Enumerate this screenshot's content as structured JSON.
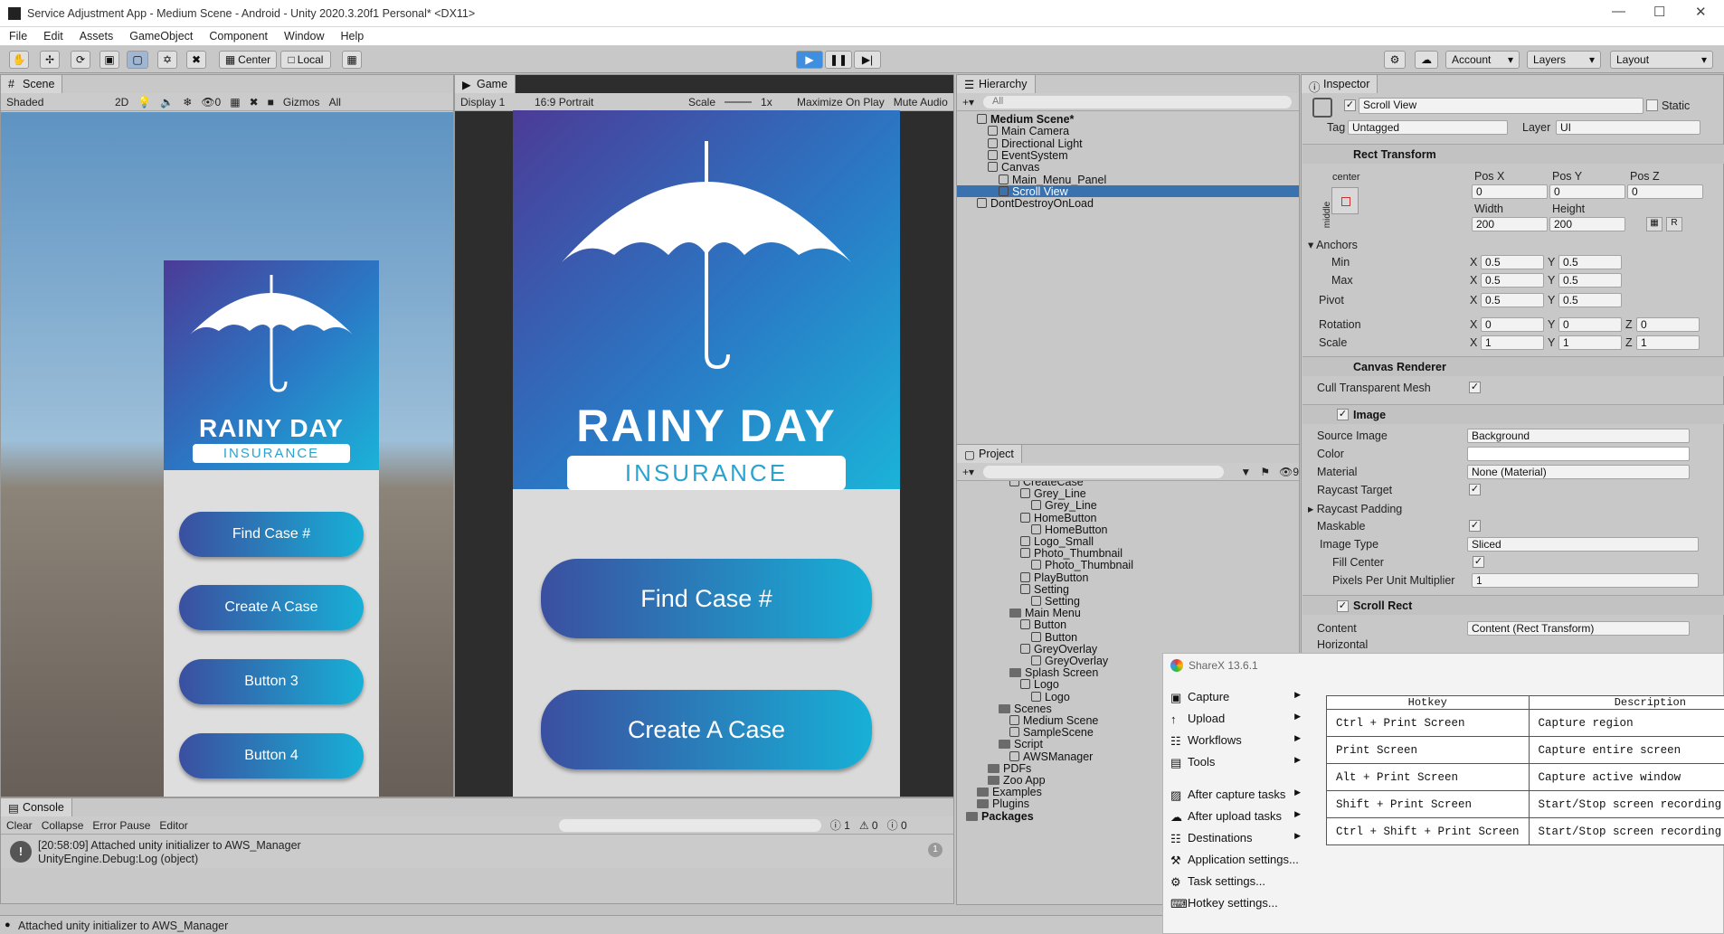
{
  "window": {
    "title": "Service Adjustment App - Medium Scene - Android - Unity 2020.3.20f1 Personal* <DX11>"
  },
  "menu": [
    "File",
    "Edit",
    "Assets",
    "GameObject",
    "Component",
    "Window",
    "Help"
  ],
  "toolbar": {
    "pivot_label": "Center",
    "space_label": "Local",
    "account": "Account",
    "layers": "Layers",
    "layout": "Layout"
  },
  "scene": {
    "tab": "Scene",
    "shading": "Shaded",
    "mode2d": "2D",
    "gizmos": "Gizmos",
    "hidden_count": "0",
    "search_hint": "All"
  },
  "game": {
    "tab": "Game",
    "display": "Display 1",
    "aspect": "16:9 Portrait",
    "scale_label": "Scale",
    "scale_value": "1x",
    "maximize": "Maximize On Play",
    "mute": "Mute Audio"
  },
  "app_screen": {
    "title": "RAINY DAY",
    "subtitle": "INSURANCE",
    "buttons": [
      "Find Case #",
      "Create A Case",
      "Button 3",
      "Button 4"
    ]
  },
  "hierarchy": {
    "tab": "Hierarchy",
    "search": "All",
    "items": [
      {
        "label": "Medium Scene*",
        "depth": 0,
        "kind": "scene"
      },
      {
        "label": "Main Camera",
        "depth": 1,
        "kind": "obj"
      },
      {
        "label": "Directional Light",
        "depth": 1,
        "kind": "obj"
      },
      {
        "label": "EventSystem",
        "depth": 1,
        "kind": "obj"
      },
      {
        "label": "Canvas",
        "depth": 1,
        "kind": "obj"
      },
      {
        "label": "Main_Menu_Panel",
        "depth": 2,
        "kind": "obj"
      },
      {
        "label": "Scroll View",
        "depth": 2,
        "kind": "obj"
      },
      {
        "label": "DontDestroyOnLoad",
        "depth": 0,
        "kind": "scene"
      }
    ]
  },
  "project": {
    "tab": "Project",
    "hidden_count": "9",
    "items": [
      {
        "label": "CreateCase",
        "depth": 4,
        "kind": "obj"
      },
      {
        "label": "Grey_Line",
        "depth": 5,
        "kind": "obj"
      },
      {
        "label": "Grey_Line",
        "depth": 6,
        "kind": "obj"
      },
      {
        "label": "HomeButton",
        "depth": 5,
        "kind": "obj"
      },
      {
        "label": "HomeButton",
        "depth": 6,
        "kind": "obj"
      },
      {
        "label": "Logo_Small",
        "depth": 5,
        "kind": "obj"
      },
      {
        "label": "Photo_Thumbnail",
        "depth": 5,
        "kind": "obj"
      },
      {
        "label": "Photo_Thumbnail",
        "depth": 6,
        "kind": "obj"
      },
      {
        "label": "PlayButton",
        "depth": 5,
        "kind": "obj"
      },
      {
        "label": "Setting",
        "depth": 5,
        "kind": "obj"
      },
      {
        "label": "Setting",
        "depth": 6,
        "kind": "obj"
      },
      {
        "label": "Main Menu",
        "depth": 4,
        "kind": "folder"
      },
      {
        "label": "Button",
        "depth": 5,
        "kind": "obj"
      },
      {
        "label": "Button",
        "depth": 6,
        "kind": "obj"
      },
      {
        "label": "GreyOverlay",
        "depth": 5,
        "kind": "obj"
      },
      {
        "label": "GreyOverlay",
        "depth": 6,
        "kind": "obj"
      },
      {
        "label": "Splash Screen",
        "depth": 4,
        "kind": "folder"
      },
      {
        "label": "Logo",
        "depth": 5,
        "kind": "obj"
      },
      {
        "label": "Logo",
        "depth": 6,
        "kind": "obj"
      },
      {
        "label": "Scenes",
        "depth": 3,
        "kind": "folder"
      },
      {
        "label": "Medium Scene",
        "depth": 4,
        "kind": "obj"
      },
      {
        "label": "SampleScene",
        "depth": 4,
        "kind": "obj"
      },
      {
        "label": "Script",
        "depth": 3,
        "kind": "folder"
      },
      {
        "label": "AWSManager",
        "depth": 4,
        "kind": "obj"
      },
      {
        "label": "PDFs",
        "depth": 2,
        "kind": "folder"
      },
      {
        "label": "Zoo App",
        "depth": 2,
        "kind": "folder"
      },
      {
        "label": "Examples",
        "depth": 1,
        "kind": "folder"
      },
      {
        "label": "Plugins",
        "depth": 1,
        "kind": "folder"
      },
      {
        "label": "Packages",
        "depth": 0,
        "kind": "folder"
      }
    ]
  },
  "inspector": {
    "tab": "Inspector",
    "object_name": "Scroll View",
    "static": "Static",
    "tag_label": "Tag",
    "tag": "Untagged",
    "layer_label": "Layer",
    "layer": "UI",
    "rect_transform": {
      "title": "Rect Transform",
      "anchor_preset": "center",
      "anchor_side": "middle",
      "pos_x_label": "Pos X",
      "pos_y_label": "Pos Y",
      "pos_z_label": "Pos Z",
      "pos_x": "0",
      "pos_y": "0",
      "pos_z": "0",
      "width_label": "Width",
      "height_label": "Height",
      "width": "200",
      "height": "200",
      "anchors": "Anchors",
      "min": "Min",
      "max": "Max",
      "pivot": "Pivot",
      "x": "X",
      "y": "Y",
      "z": "Z",
      "half": "0.5",
      "rotation": "Rotation",
      "scale": "Scale",
      "zero": "0",
      "one": "1",
      "r": "R"
    },
    "canvas_renderer": {
      "title": "Canvas Renderer",
      "cull": "Cull Transparent Mesh"
    },
    "image": {
      "title": "Image",
      "source_label": "Source Image",
      "source": "Background",
      "color_label": "Color",
      "material_label": "Material",
      "material": "None (Material)",
      "raycast": "Raycast Target",
      "padding": "Raycast Padding",
      "maskable": "Maskable",
      "type_label": "Image Type",
      "type": "Sliced",
      "fill": "Fill Center",
      "ppu_label": "Pixels Per Unit Multiplier",
      "ppu": "1"
    },
    "scroll_rect": {
      "title": "Scroll Rect",
      "content_label": "Content",
      "content": "Content (Rect Transform)",
      "horizontal": "Horizontal"
    }
  },
  "console": {
    "tab": "Console",
    "clear": "Clear",
    "collapse": "Collapse",
    "error_pause": "Error Pause",
    "editor": "Editor",
    "counts": [
      "1",
      "0",
      "0"
    ],
    "log_line1": "[20:58:09] Attached unity initializer to AWS_Manager",
    "log_line2": "UnityEngine.Debug:Log (object)",
    "log_count": "1"
  },
  "status": "Attached unity initializer to AWS_Manager",
  "sharex": {
    "title": "ShareX 13.6.1",
    "menu": [
      {
        "label": "Capture",
        "icon": "camera-icon",
        "submenu": true
      },
      {
        "label": "Upload",
        "icon": "upload-arrow-icon",
        "submenu": true
      },
      {
        "label": "Workflows",
        "icon": "grid-icon",
        "submenu": true
      },
      {
        "label": "Tools",
        "icon": "toolbox-icon",
        "submenu": true
      },
      {
        "label": "After capture tasks",
        "icon": "image-icon",
        "submenu": true
      },
      {
        "label": "After upload tasks",
        "icon": "cloud-icon",
        "submenu": true
      },
      {
        "label": "Destinations",
        "icon": "globe-grid-icon",
        "submenu": true
      },
      {
        "label": "Application settings...",
        "icon": "wrench-icon",
        "submenu": false
      },
      {
        "label": "Task settings...",
        "icon": "gear-icon",
        "submenu": false
      },
      {
        "label": "Hotkey settings...",
        "icon": "keyboard-icon",
        "submenu": false
      }
    ],
    "hotkey_header": "Hotkey",
    "desc_header": "Description",
    "hotkeys": [
      {
        "key": "Ctrl + Print Screen",
        "desc": "Capture region"
      },
      {
        "key": "Print Screen",
        "desc": "Capture entire screen"
      },
      {
        "key": "Alt + Print Screen",
        "desc": "Capture active window"
      },
      {
        "key": "Shift + Print Screen",
        "desc": "Start/Stop screen recording"
      },
      {
        "key": "Ctrl + Shift + Print Screen",
        "desc": "Start/Stop screen recording (GIF)"
      }
    ]
  },
  "colors": {
    "selection": "#3a72b0",
    "accent": "#1a9fd0",
    "brand_gradient_start": "#4b3b97",
    "brand_gradient_end": "#1bb3d8"
  }
}
